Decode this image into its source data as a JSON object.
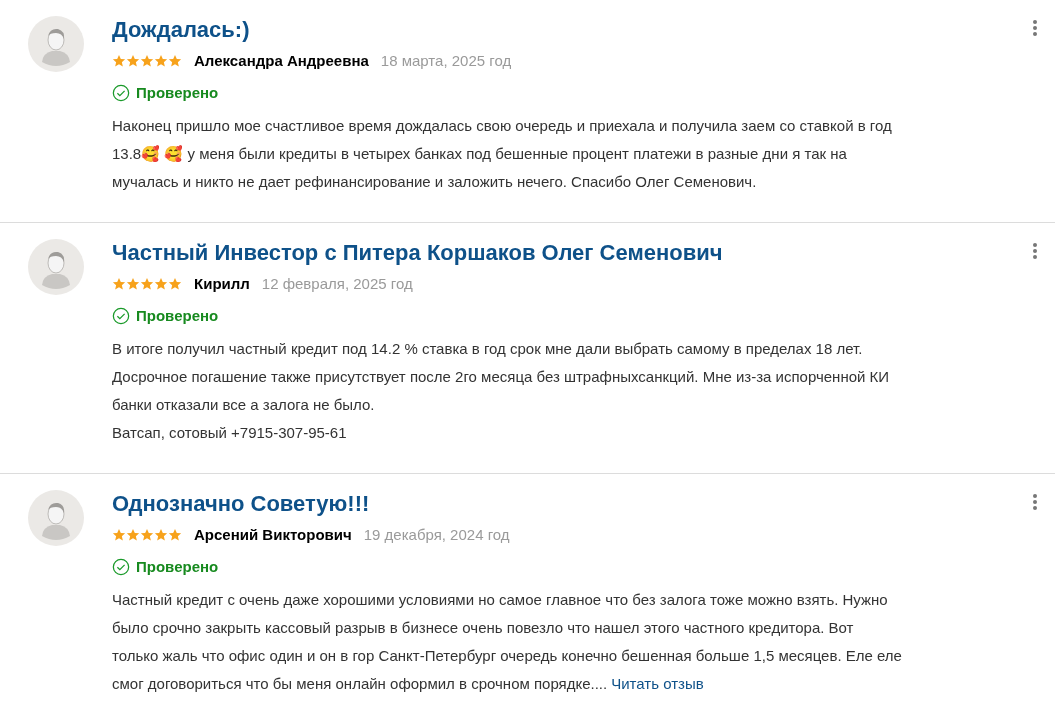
{
  "reviews": [
    {
      "title": "Дождалась:)",
      "stars": 5,
      "author": "Александра Андреевна",
      "date": "18 марта, 2025 год",
      "verified": "Проверено",
      "body_lines": [
        "Наконец пришло мое счастливое время дождалась свою очередь и приехала и получила заем со ставкой в год",
        "13.8🥰 🥰 у меня были кредиты в четырех банках под бешенные процент платежи в разные дни я так на",
        "мучалась и никто не дает рефинансирование и заложить нечего. Спасибо Олег Семенович."
      ]
    },
    {
      "title": "Частный Инвестор с Питера Коршаков Олег Семенович",
      "stars": 5,
      "author": "Кирилл",
      "date": "12 февраля, 2025 год",
      "verified": "Проверено",
      "body_lines": [
        "В итоге получил частный кредит под 14.2 % ставка в год срок мне дали выбрать самому в пределах 18 лет.",
        "Досрочное погашение также присутствует после 2го месяца без штрафныхсанкций. Мне из-за испорченной КИ",
        "банки отказали все а залога не было.",
        "Ватсап, сотовый +7915-307-95-61"
      ]
    },
    {
      "title": "Однозначно Советую!!!",
      "stars": 5,
      "author": "Арсений Викторович",
      "date": "19 декабря, 2024 год",
      "verified": "Проверено",
      "body_lines": [
        "Частный кредит с очень даже хорошими условиями но самое главное что без залога тоже можно взять. Нужно",
        "было срочно закрыть кассовый разрыв в бизнесе очень повезло что нашел этого частного кредитора. Вот",
        "только жаль что офис один и он в гор Санкт-Петербург очередь конечно бешенная больше 1,5 месяцев. Еле еле",
        "смог договориться что бы меня онлайн оформил в срочном порядке...."
      ],
      "more_link": "Читать отзыв"
    }
  ]
}
